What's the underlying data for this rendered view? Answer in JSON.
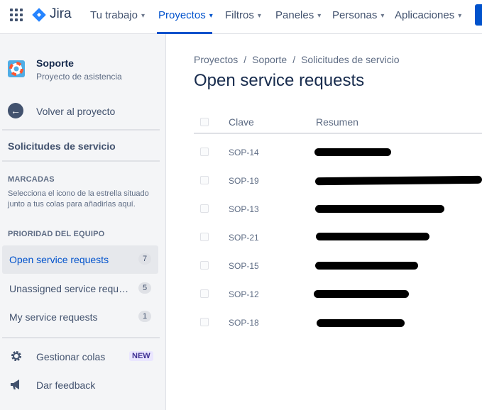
{
  "nav": {
    "logo_text": "Jira",
    "items": [
      {
        "label": "Tu trabajo"
      },
      {
        "label": "Proyectos"
      },
      {
        "label": "Filtros"
      },
      {
        "label": "Paneles"
      },
      {
        "label": "Personas"
      },
      {
        "label": "Aplicaciones"
      }
    ],
    "active_index": 1,
    "chevron": "▾"
  },
  "sidebar": {
    "project_name": "Soporte",
    "project_type": "Proyecto de asistencia",
    "back_label": "Volver al proyecto",
    "section_title": "Solicitudes de servicio",
    "starred_heading": "MARCADAS",
    "starred_note": "Selecciona el icono de la estrella situado junto a tus colas para añadirlas aquí.",
    "team_heading": "PRIORIDAD DEL EQUIPO",
    "queues": [
      {
        "label": "Open service requests",
        "count": "7",
        "active": true
      },
      {
        "label": "Unassigned service requests",
        "count": "5",
        "active": false
      },
      {
        "label": "My service requests",
        "count": "1",
        "active": false
      }
    ],
    "manage_label": "Gestionar colas",
    "new_badge": "NEW",
    "feedback_label": "Dar feedback"
  },
  "main": {
    "breadcrumbs": [
      "Proyectos",
      "Soporte",
      "Solicitudes de servicio"
    ],
    "breadcrumb_separator": "/",
    "title": "Open service requests",
    "columns": [
      "Clave",
      "Resumen"
    ],
    "rows": [
      {
        "key": "SOP-14"
      },
      {
        "key": "SOP-19"
      },
      {
        "key": "SOP-13"
      },
      {
        "key": "SOP-21"
      },
      {
        "key": "SOP-15"
      },
      {
        "key": "SOP-12"
      },
      {
        "key": "SOP-18"
      }
    ]
  },
  "colors": {
    "accent": "#0052cc",
    "sidebar_bg": "#f4f5f7",
    "text": "#172b4d"
  }
}
